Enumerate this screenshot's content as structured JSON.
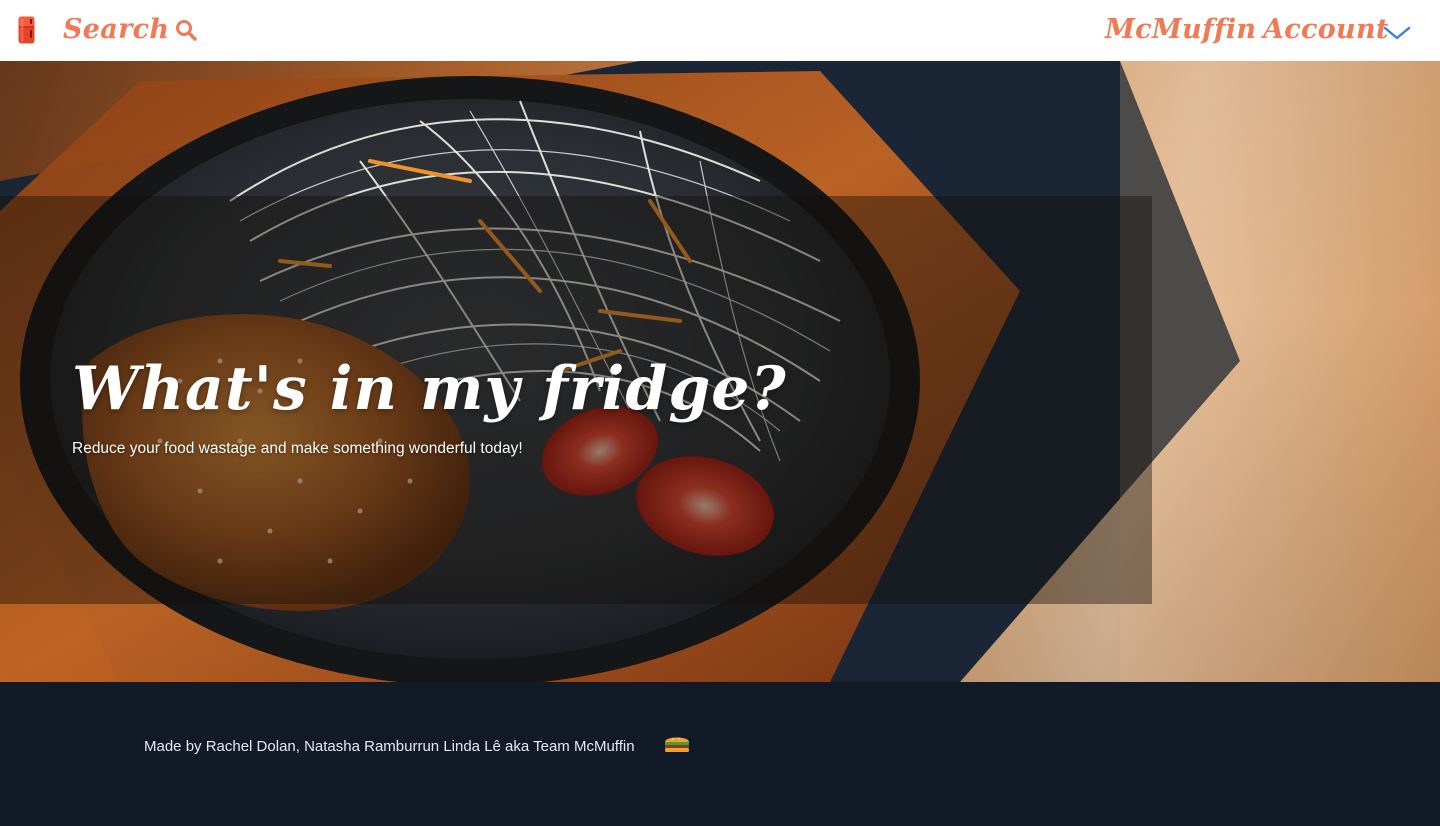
{
  "colors": {
    "accent": "#f07a56",
    "chevron": "#3b7fe0",
    "header_bg": "#ffffff",
    "footer_bg": "#121a28",
    "hero_text": "#ffffff",
    "footer_text": "#e6e9ef"
  },
  "header": {
    "logo_icon": "fridge-icon",
    "search_label": "Search",
    "search_icon": "magnifier-icon",
    "brand_label": "McMuffin",
    "account_label": "Account",
    "account_icon": "chevron-down-icon"
  },
  "hero": {
    "title": "What's in my fridge?",
    "subtitle": "Reduce your food wastage and make something wonderful today!"
  },
  "footer": {
    "text": "Made by Rachel Dolan, Natasha Ramburrun Linda Lê aka Team McMuffin",
    "emoji_icon": "burger-icon"
  }
}
